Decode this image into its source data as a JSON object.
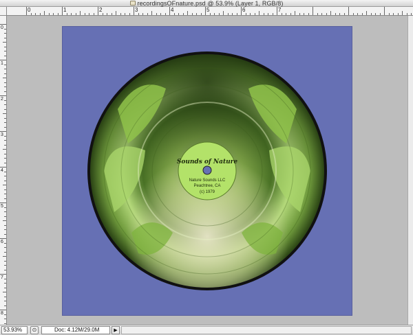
{
  "window": {
    "title": "recordingsOFnature.psd @ 53.9% (Layer 1, RGB/8)"
  },
  "rulers": {
    "top_labels": [
      "0",
      "1",
      "2",
      "3",
      "4",
      "5",
      "6",
      "7"
    ],
    "left_labels": [
      "0",
      "1",
      "2",
      "3",
      "4",
      "5",
      "6",
      "7",
      "8"
    ]
  },
  "record_label": {
    "title": "Sounds of Nature",
    "line1": "Nature Sounds LLC",
    "line2": "Peachtree, CA",
    "line3": "(c) 1979"
  },
  "colors": {
    "canvas_background": "#6670b4",
    "label_green": "#b3e269",
    "record_green": "#9fcf58"
  },
  "statusbar": {
    "zoom": "53.93%",
    "doc": "Doc: 4.12M/29.0M",
    "menu_arrow": "▶"
  }
}
